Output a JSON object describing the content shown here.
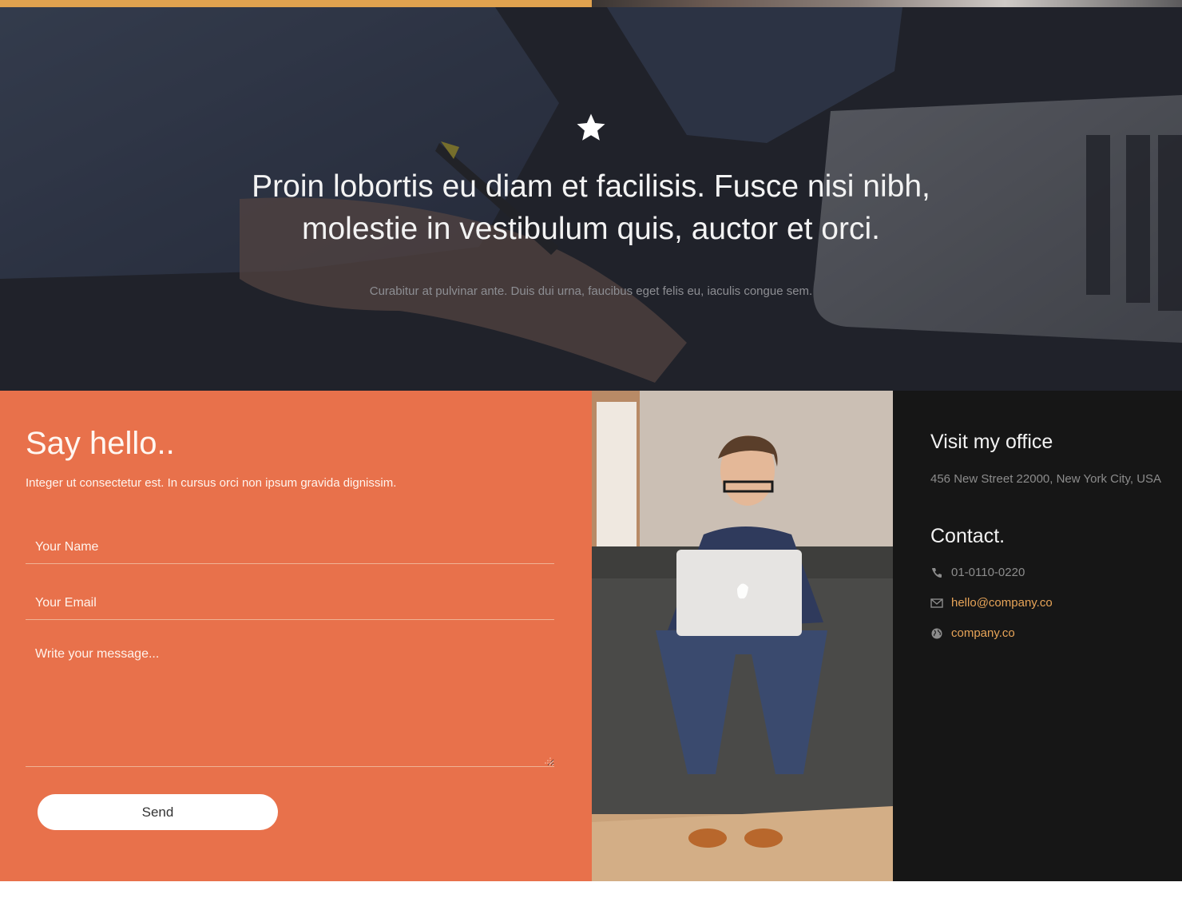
{
  "colors": {
    "accent_orange": "#e8714b",
    "top_strip": "#e0a24f",
    "link": "#e7a458",
    "dark_panel": "#161616",
    "button_bg": "#ffffff"
  },
  "hero": {
    "icon": "star-icon",
    "quote_line1": "Proin lobortis eu diam et facilisis. Fusce nisi nibh,",
    "quote_line2": "molestie in vestibulum quis, auctor et orci.",
    "subtext": "Curabitur at pulvinar ante. Duis dui urna, faucibus eget felis eu, iaculis congue sem."
  },
  "contact_form": {
    "title": "Say hello..",
    "subtitle": "Integer ut consectetur est. In cursus orci non ipsum gravida dignissim.",
    "name_placeholder": "Your Name",
    "email_placeholder": "Your Email",
    "message_placeholder": "Write your message...",
    "send_label": "Send"
  },
  "office": {
    "title": "Visit my office",
    "address": "456 New Street 22000, New York City, USA"
  },
  "contact": {
    "title": "Contact.",
    "phone": "01-0110-0220",
    "email": "hello@company.co",
    "website": "company.co",
    "icons": [
      "phone-icon",
      "envelope-icon",
      "globe-icon"
    ]
  }
}
